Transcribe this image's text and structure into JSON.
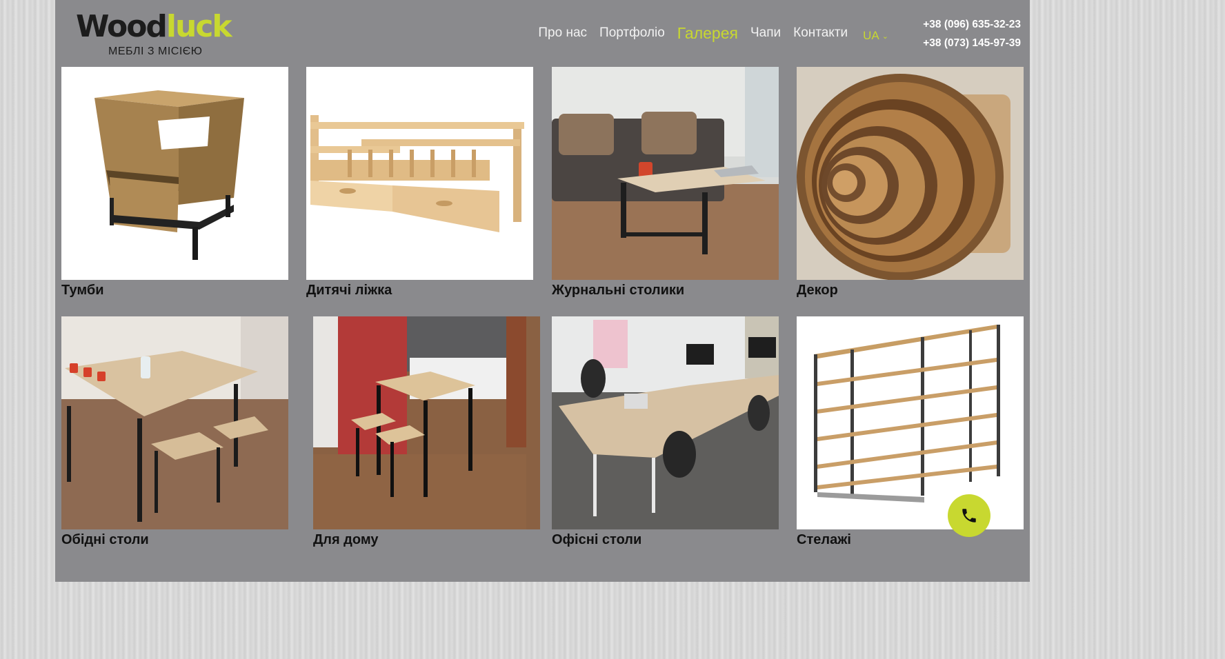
{
  "brand": {
    "wood": "Wood",
    "luck": "luck",
    "tagline": "МЕБЛІ З МІСІЄЮ"
  },
  "nav": [
    {
      "label": "Про нас",
      "active": false
    },
    {
      "label": "Портфоліо",
      "active": false
    },
    {
      "label": "Галерея",
      "active": true
    },
    {
      "label": "Чапи",
      "active": false
    },
    {
      "label": "Контакти",
      "active": false
    }
  ],
  "language": "UA",
  "phones": [
    "+38 (096) 635-32-23",
    "+38 (073) 145-97-39"
  ],
  "gallery": [
    {
      "title": "Тумби",
      "image": "wooden-nightstand-photo"
    },
    {
      "title": "Дитячі ліжка",
      "image": "kids-bed-photo"
    },
    {
      "title": "Журнальні столики",
      "image": "coffee-table-photo"
    },
    {
      "title": "Декор",
      "image": "wooden-trays-photo"
    },
    {
      "title": "Обідні столи",
      "image": "dining-table-photo"
    },
    {
      "title": "Для дому",
      "image": "bar-table-photo"
    },
    {
      "title": "Офісні столи",
      "image": "office-desks-photo"
    },
    {
      "title": "Стелажі",
      "image": "shelving-rack-photo"
    }
  ],
  "colors": {
    "accent": "#c8d830",
    "panel": "#8a8a8d",
    "text_light": "#f2f2f2",
    "text_dark": "#111111"
  },
  "icons": {
    "call": "phone-icon",
    "lang_dropdown": "chevron-down-icon"
  }
}
